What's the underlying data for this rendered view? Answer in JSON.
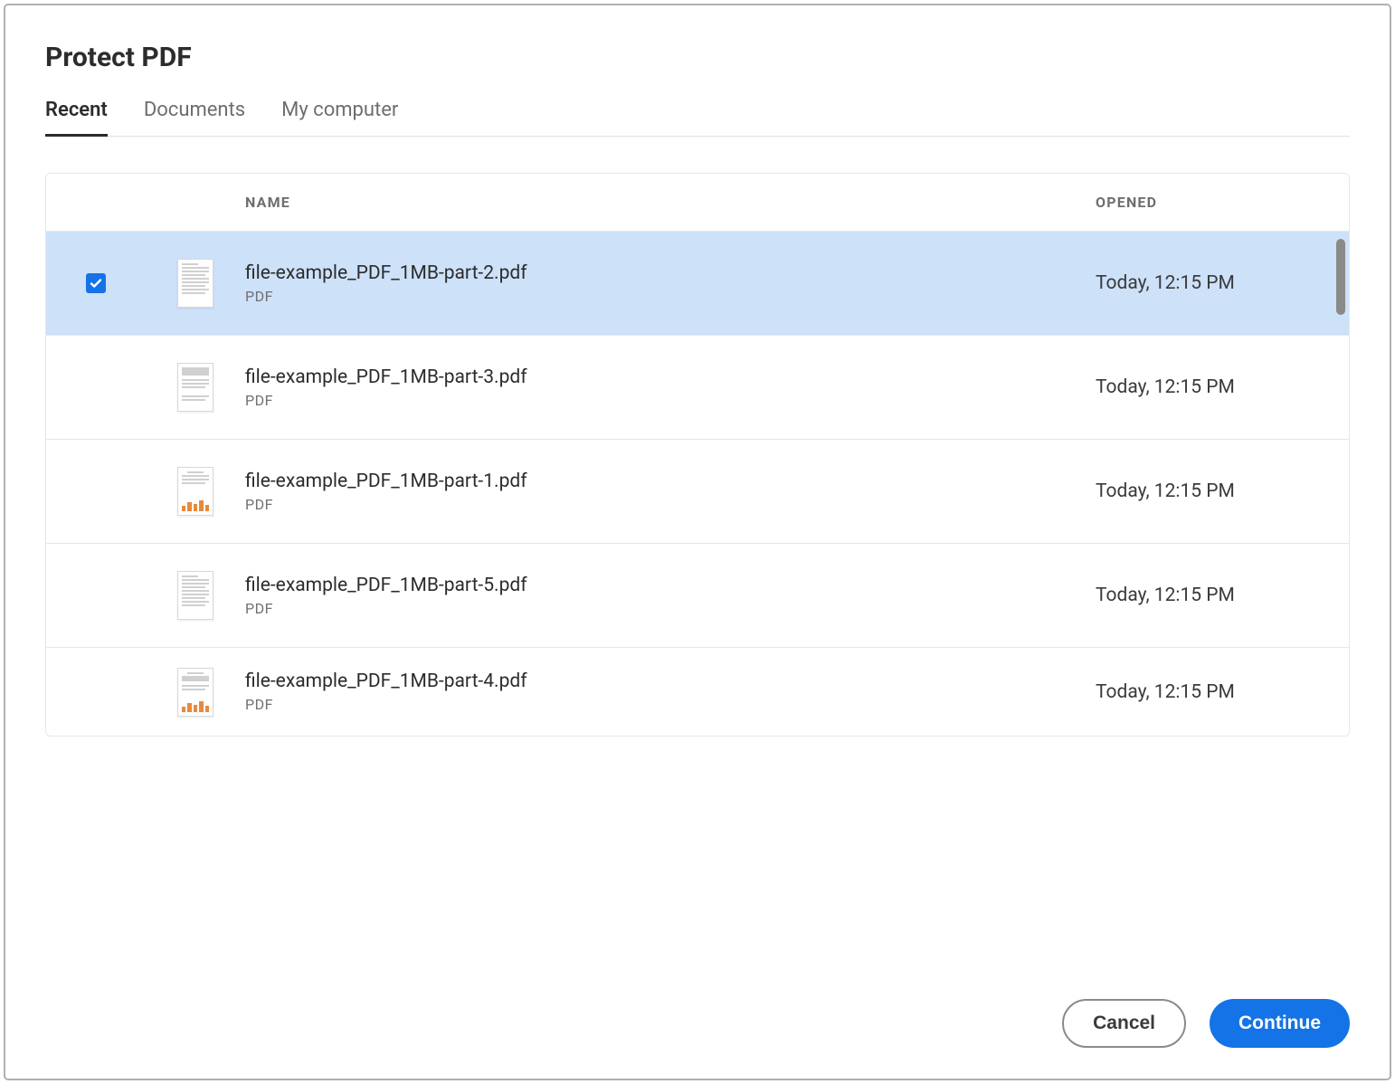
{
  "dialog": {
    "title": "Protect PDF"
  },
  "tabs": [
    {
      "label": "Recent",
      "active": true
    },
    {
      "label": "Documents",
      "active": false
    },
    {
      "label": "My computer",
      "active": false
    }
  ],
  "columns": {
    "name": "NAME",
    "opened": "OPENED"
  },
  "files": [
    {
      "name": "file-example_PDF_1MB-part-2.pdf",
      "type": "PDF",
      "opened": "Today, 12:15 PM",
      "selected": true,
      "thumb": "text"
    },
    {
      "name": "file-example_PDF_1MB-part-3.pdf",
      "type": "PDF",
      "opened": "Today, 12:15 PM",
      "selected": false,
      "thumb": "header"
    },
    {
      "name": "file-example_PDF_1MB-part-1.pdf",
      "type": "PDF",
      "opened": "Today, 12:15 PM",
      "selected": false,
      "thumb": "chart"
    },
    {
      "name": "file-example_PDF_1MB-part-5.pdf",
      "type": "PDF",
      "opened": "Today, 12:15 PM",
      "selected": false,
      "thumb": "text"
    },
    {
      "name": "file-example_PDF_1MB-part-4.pdf",
      "type": "PDF",
      "opened": "Today, 12:15 PM",
      "selected": false,
      "thumb": "chart"
    }
  ],
  "buttons": {
    "cancel": "Cancel",
    "continue": "Continue"
  }
}
